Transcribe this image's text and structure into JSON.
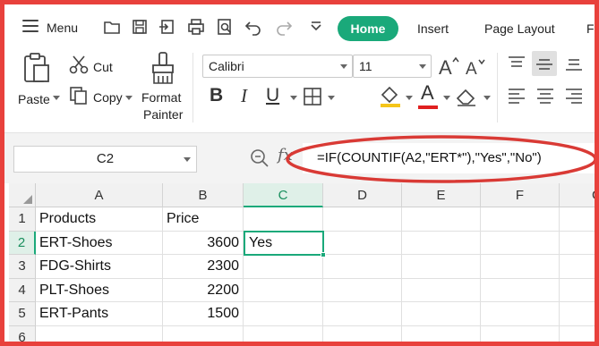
{
  "menubar": {
    "menu_label": "Menu",
    "quick_icons": [
      "folder-icon",
      "save-icon",
      "export-icon",
      "print-icon",
      "print-preview-icon",
      "undo-icon",
      "redo-icon",
      "customize-dropdown-icon"
    ],
    "tabs": [
      {
        "label": "Home",
        "active": true
      },
      {
        "label": "Insert",
        "active": false
      },
      {
        "label": "Page Layout",
        "active": false
      },
      {
        "label": "Fo",
        "active": false
      }
    ],
    "accent_color": "#1aa97a"
  },
  "ribbon": {
    "paste_label": "Paste",
    "cut_label": "Cut",
    "copy_label": "Copy",
    "format_painter_line1": "Format",
    "format_painter_line2": "Painter",
    "font_name": "Calibri",
    "font_size": "11",
    "bold_label": "B",
    "italic_label": "I",
    "underline_label": "U",
    "font_color_label": "A"
  },
  "formula_bar": {
    "name_box": "C2",
    "formula": "=IF(COUNTIF(A2,\"ERT*\"),\"Yes\",\"No\")",
    "fx_label": "fx",
    "highlight_color": "#d93a35"
  },
  "grid": {
    "columns": [
      "A",
      "B",
      "C",
      "D",
      "E",
      "F",
      "G"
    ],
    "active_column": "C",
    "rows": [
      {
        "num": "1",
        "A": "Products",
        "B": "Price",
        "C": ""
      },
      {
        "num": "2",
        "A": "ERT-Shoes",
        "B": "3600",
        "C": "Yes"
      },
      {
        "num": "3",
        "A": "FDG-Shirts",
        "B": "2300",
        "C": ""
      },
      {
        "num": "4",
        "A": "PLT-Shoes",
        "B": "2200",
        "C": ""
      },
      {
        "num": "5",
        "A": "ERT-Pants",
        "B": "1500",
        "C": ""
      },
      {
        "num": "6",
        "A": "",
        "B": "",
        "C": ""
      }
    ],
    "active_row": "2"
  }
}
